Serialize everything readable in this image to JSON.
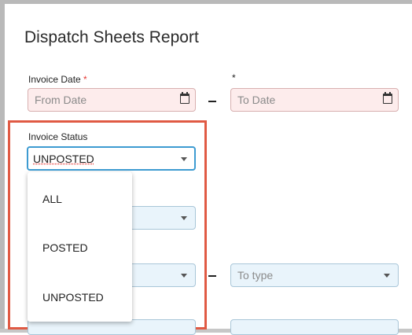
{
  "report": {
    "title": "Dispatch Sheets Report"
  },
  "invoice_date": {
    "label": "Invoice Date",
    "required_mark": "*",
    "to_required_mark": "*",
    "from_placeholder": "From Date",
    "to_placeholder": "To Date"
  },
  "invoice_status": {
    "label": "Invoice Status",
    "selected": "UNPOSTED",
    "options": [
      "ALL",
      "POSTED",
      "UNPOSTED"
    ]
  },
  "type_range": {
    "to_placeholder": "To type"
  },
  "colors": {
    "highlight": "#e05a44",
    "field_bg": "#e9f4fb",
    "required_bg": "#fdecec",
    "focus_border": "#3d9bd1"
  }
}
